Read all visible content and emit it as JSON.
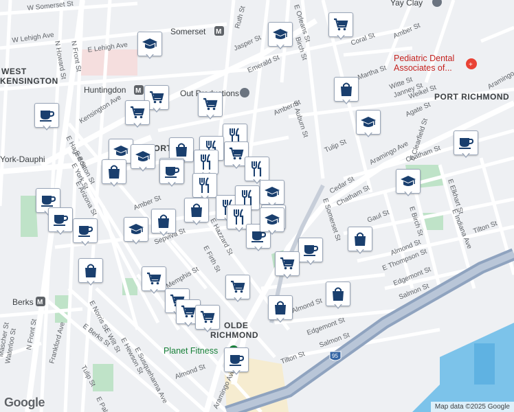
{
  "map": {
    "attribution": "Map data ©2025 Google",
    "logo_text": "Google",
    "colors": {
      "background": "#eef0f3",
      "road": "#ffffff",
      "highway": "#8fa3bf",
      "water": "#7cc3ea",
      "park": "#bfe3c8",
      "marker_fill": "#1a3f6e",
      "marker_border": "#9aa6b8"
    },
    "places": {
      "west_kensington_1": "WEST",
      "west_kensington_2": "KENSINGTON",
      "port_richmond": "PORT RICHMOND",
      "port_text": "PORT",
      "olde_1": "OLDE",
      "olde_2": "RICHMOND"
    },
    "transit": {
      "somerset": "Somerset",
      "huntingdon": "Huntingdon",
      "york_dauphin": "York-Dauphi",
      "berks": "Berks"
    },
    "pois": {
      "dental_1": "Pediatric Dental",
      "dental_2": "Associates of...",
      "planet_fitness": "Planet Fitness",
      "productions": "Out Productions",
      "yay_clay": "Yay Clay"
    },
    "streets": {
      "w_somerset": "W Somerset St",
      "w_lehigh": "W Lehigh Ave",
      "e_lehigh": "E Lehigh Ave",
      "n_howard": "N Howard St",
      "n_front": "N Front St",
      "n_front_2": "N Front St",
      "kensington": "Kensington Ave",
      "ruth": "Ruth St",
      "e_orleans": "E Orleans St",
      "birch": "Birch St",
      "jasper": "Jasper St",
      "emerald": "Emerald St",
      "amber_top": "Amber St",
      "coral": "Coral St",
      "martha": "Martha St",
      "witte": "Witte St",
      "janney": "Janney St",
      "weikel": "Weikel St",
      "amber_mid": "Amber St",
      "e_auburn": "E Auburn St",
      "tulip_mid": "Tulip St",
      "agate": "Agate St",
      "aramingo": "Aramingo Ave",
      "aramingo_2": "Aramingo",
      "e_clearfield": "E Clearfield St",
      "e_elkhart": "E Elkhart St",
      "e_indiana": "E Indiana Ave",
      "tilton_right": "Tilton St",
      "cedar": "Cedar St",
      "chatham": "Chatham St",
      "chatham_2": "Chatham St",
      "e_somerset": "E Somerset St",
      "gaul": "Gaul St",
      "almond_right": "Almond St",
      "e_thompson": "E Thompson St",
      "birch_2": "E Birch St",
      "edgemont_right": "Edgemont St",
      "salmon_right": "Salmon St",
      "e_hagert": "E Hagert St",
      "e_boston": "E Boston St",
      "e_york": "E York St",
      "e_arizona": "E Arizona St",
      "amber_left": "Amber St",
      "sepviva": "Sepviva St",
      "e_hazzard": "E Hazzard St",
      "e_firth": "E Firth St",
      "e_memphis": "Memphis St",
      "e_norris": "E Norris St",
      "e_berks": "E Berks St",
      "e_wilt": "E Wilt St",
      "e_hewson": "E Hewson St",
      "e_susquehanna": "E Susquehanna Ave",
      "frankford": "Frankford Ave",
      "tulip_bottom": "Tulip St",
      "almond_bottom": "Almond St",
      "almond_mid": "Almond St",
      "edgemont_bottom": "Edgemont St",
      "salmon_bottom": "Salmon St",
      "tilton_bottom": "Tilton St",
      "aramingo_bottom": "Aramingo Ave",
      "e_palmer": "E Palmer St",
      "waterloo": "Waterloo St",
      "mascher": "Mascher St",
      "i95": "95"
    },
    "markers": [
      {
        "icon": "cart"
      },
      {
        "icon": "school"
      },
      {
        "icon": "school"
      },
      {
        "icon": "cart"
      },
      {
        "icon": "cart"
      },
      {
        "icon": "bag"
      },
      {
        "icon": "coffee"
      },
      {
        "icon": "school"
      },
      {
        "icon": "cart"
      },
      {
        "icon": "school"
      },
      {
        "icon": "school"
      },
      {
        "icon": "bag"
      },
      {
        "icon": "bag"
      },
      {
        "icon": "coffee"
      },
      {
        "icon": "restaurant"
      },
      {
        "icon": "cart"
      },
      {
        "icon": "restaurant"
      },
      {
        "icon": "coffee"
      },
      {
        "icon": "restaurant"
      },
      {
        "icon": "restaurant"
      },
      {
        "icon": "restaurant"
      },
      {
        "icon": "school"
      },
      {
        "icon": "coffee"
      },
      {
        "icon": "coffee"
      },
      {
        "icon": "coffee"
      },
      {
        "icon": "bag"
      },
      {
        "icon": "school"
      },
      {
        "icon": "bag"
      },
      {
        "icon": "restaurant"
      },
      {
        "icon": "restaurant"
      },
      {
        "icon": "restaurant"
      },
      {
        "icon": "school"
      },
      {
        "icon": "coffee"
      },
      {
        "icon": "cart"
      },
      {
        "icon": "bag"
      },
      {
        "icon": "coffee"
      },
      {
        "icon": "bag"
      },
      {
        "icon": "cart"
      },
      {
        "icon": "cart"
      },
      {
        "icon": "cart"
      },
      {
        "icon": "cart"
      },
      {
        "icon": "bag"
      },
      {
        "icon": "cart"
      },
      {
        "icon": "coffee"
      },
      {
        "icon": "bag"
      },
      {
        "icon": "coffee"
      },
      {
        "icon": "school"
      },
      {
        "icon": "coffee"
      }
    ]
  }
}
